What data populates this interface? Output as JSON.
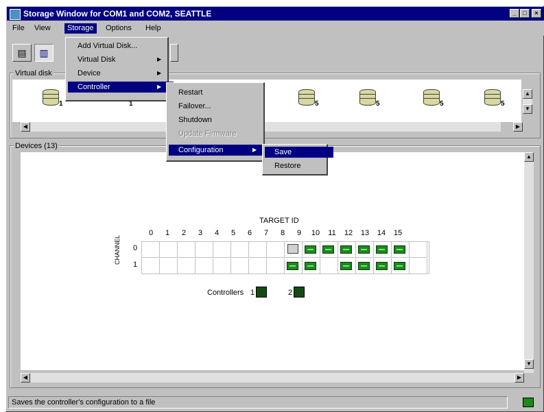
{
  "window": {
    "title": "Storage Window for COM1 and COM2, SEATTLE"
  },
  "title_buttons": {
    "minimize": "_",
    "maximize": "□",
    "close": "×"
  },
  "menubar": [
    "File",
    "View",
    "Storage",
    "Options",
    "Help"
  ],
  "storage_menu": {
    "items": [
      {
        "label": "Add Virtual Disk...",
        "submenu": false
      },
      {
        "label": "Virtual Disk",
        "submenu": true
      },
      {
        "label": "Device",
        "submenu": true
      },
      {
        "label": "Controller",
        "submenu": true
      }
    ]
  },
  "controller_menu": {
    "items": [
      {
        "label": "Restart"
      },
      {
        "label": "Failover..."
      },
      {
        "label": "Shutdown"
      },
      {
        "label": "Update Firmware"
      },
      {
        "label": "Configuration"
      }
    ]
  },
  "configuration_menu": {
    "items": [
      {
        "label": "Save"
      },
      {
        "label": "Restore"
      }
    ]
  },
  "virtual_disks": {
    "label": "Virtual disk",
    "items": [
      "1",
      "1",
      "5",
      "5",
      "5",
      "5"
    ]
  },
  "devices": {
    "label": "Devices (13)",
    "target_id_label": "TARGET ID",
    "channel_label": "CHANNEL",
    "columns": [
      "0",
      "1",
      "2",
      "3",
      "4",
      "5",
      "6",
      "7",
      "8",
      "9",
      "10",
      "11",
      "12",
      "13",
      "14",
      "15"
    ],
    "rows": [
      {
        "label": "0",
        "cells": [
          "",
          "",
          "",
          "",
          "",
          "",
          "",
          "",
          "controller",
          "drive",
          "drive",
          "drive",
          "drive",
          "drive",
          "drive",
          ""
        ]
      },
      {
        "label": "1",
        "cells": [
          "",
          "",
          "",
          "",
          "",
          "",
          "",
          "",
          "drive",
          "drive",
          "",
          "drive",
          "drive",
          "drive",
          "drive",
          ""
        ]
      }
    ],
    "controllers_label": "Controllers",
    "controllers": [
      "1",
      "2"
    ]
  },
  "statusbar": {
    "text": "Saves the controller's configuration to a file"
  },
  "icons": {
    "toolbar_left": "storage-icon",
    "toolbar_second": "grid-view-icon",
    "disk": "database-cylinder-icon",
    "drive": "hard-drive-chip-icon",
    "controller": "controller-board-icon"
  },
  "colors": {
    "title_bg": "#000080",
    "menu_highlight": "#000080",
    "drive_green": "#1b8a1b",
    "window_gray": "#c0c0c0"
  }
}
